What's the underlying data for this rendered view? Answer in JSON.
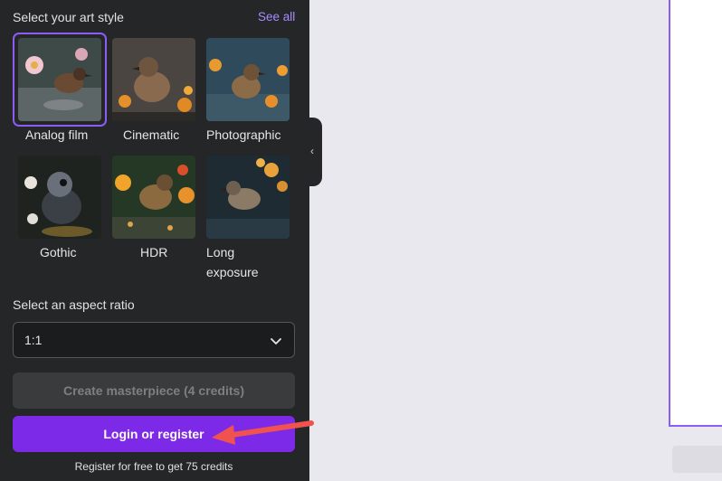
{
  "art_style": {
    "title": "Select your art style",
    "see_all": "See all",
    "styles": [
      {
        "label": "Analog film"
      },
      {
        "label": "Cinematic"
      },
      {
        "label": "Photographic"
      },
      {
        "label": "Gothic"
      },
      {
        "label": "HDR"
      },
      {
        "label": "Long exposure"
      }
    ]
  },
  "aspect_ratio": {
    "title": "Select an aspect ratio",
    "value": "1:1"
  },
  "buttons": {
    "create_label": "Create masterpiece (4 credits)",
    "login_label": "Login or register"
  },
  "footnote": "Register for free to get 75 credits",
  "colors": {
    "accent": "#7d2ae8",
    "selection": "#8b5cf6",
    "panel_bg": "#252627",
    "annotation_arrow": "#f0524f"
  },
  "icons": {
    "dropdown": "chevron-down-icon",
    "collapse": "chevron-left-icon"
  }
}
